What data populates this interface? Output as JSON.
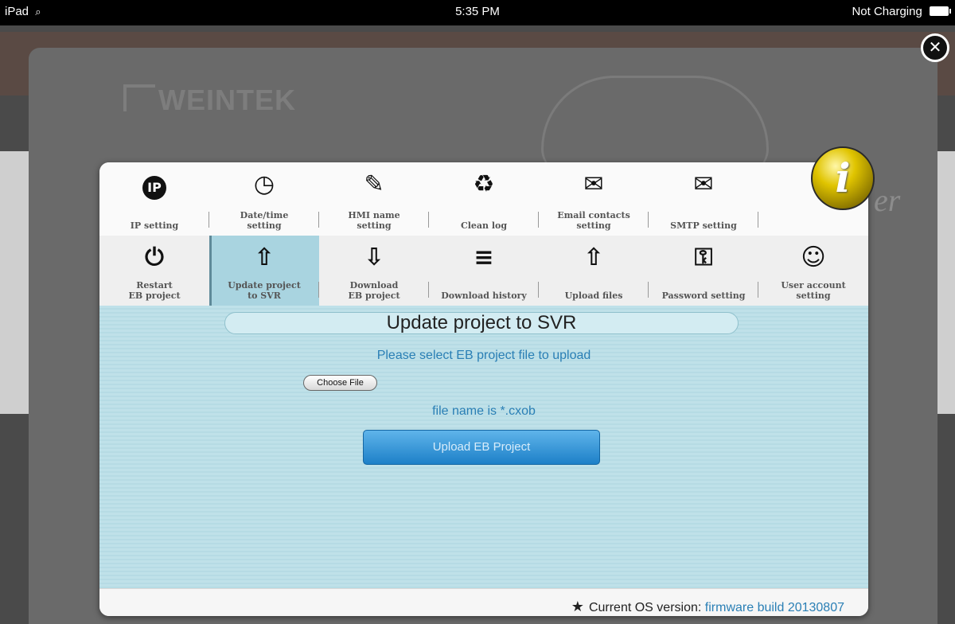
{
  "status_bar": {
    "device": "iPad",
    "time": "5:35 PM",
    "charging": "Not Charging"
  },
  "background": {
    "logo": "WEINTEK",
    "fragment": "er"
  },
  "tabs_row1": [
    {
      "label_l1": "IP setting",
      "label_l2": "",
      "icon": "ip-icon",
      "glyph": "IP"
    },
    {
      "label_l1": "Date/time",
      "label_l2": "setting",
      "icon": "clock-icon",
      "glyph": "◷"
    },
    {
      "label_l1": "HMI name",
      "label_l2": "setting",
      "icon": "pencil-icon",
      "glyph": "✎"
    },
    {
      "label_l1": "Clean log",
      "label_l2": "",
      "icon": "recycle-bin-icon",
      "glyph": "♻"
    },
    {
      "label_l1": "Email contacts",
      "label_l2": "setting",
      "icon": "email-contact-icon",
      "glyph": "✉"
    },
    {
      "label_l1": "SMTP setting",
      "label_l2": "",
      "icon": "smtp-envelope-icon",
      "glyph": "✉"
    }
  ],
  "tabs_row2": [
    {
      "label_l1": "Restart",
      "label_l2": "EB project",
      "icon": "restart-file-icon",
      "glyph": "⏻"
    },
    {
      "label_l1": "Update project",
      "label_l2": "to SVR",
      "icon": "upload-file-icon",
      "glyph": "⇧"
    },
    {
      "label_l1": "Download",
      "label_l2": "EB project",
      "icon": "download-file-icon",
      "glyph": "⇩"
    },
    {
      "label_l1": "Download history",
      "label_l2": "",
      "icon": "download-history-icon",
      "glyph": "≡"
    },
    {
      "label_l1": "Upload files",
      "label_l2": "",
      "icon": "upload-files-icon",
      "glyph": "⇧"
    },
    {
      "label_l1": "Password setting",
      "label_l2": "",
      "icon": "lock-icon",
      "glyph": "⚿"
    },
    {
      "label_l1": "User account",
      "label_l2": "setting",
      "icon": "user-key-icon",
      "glyph": "☺"
    }
  ],
  "panel": {
    "title": "Update project to SVR",
    "instruction": "Please select EB project file to upload",
    "choose_file_label": "Choose File",
    "file_hint": "file name is *.cxob",
    "upload_button": "Upload EB Project"
  },
  "footer": {
    "os_label": "Current OS version:",
    "firmware": "firmware build 20130807"
  },
  "colors": {
    "accent": "#2a7fb5",
    "active_tab": "#a9d4e0",
    "content_bg": "#bfe1e9"
  }
}
